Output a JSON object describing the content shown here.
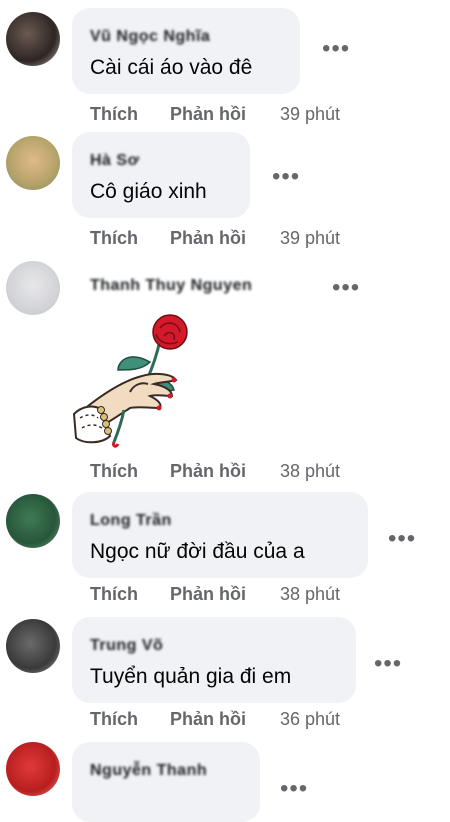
{
  "labels": {
    "like": "Thích",
    "reply": "Phản hồi"
  },
  "more_icon": "more-horizontal-icon",
  "sticker_icon": "hand-holding-rose-sticker",
  "comments": [
    {
      "author": "Vũ Ngọc Nghĩa",
      "text": "Cài cái áo vào đê",
      "time": "39 phút"
    },
    {
      "author": "Hà Sơ",
      "text": "Cô giáo xinh",
      "time": "39 phút"
    },
    {
      "author": "Thanh Thuy Nguyen",
      "text": "",
      "time": "38 phút"
    },
    {
      "author": "Long Trần",
      "text": "Ngọc nữ đời đầu của a",
      "time": "38 phút"
    },
    {
      "author": "Trung Võ",
      "text": "Tuyển quản gia đi em",
      "time": "36 phút"
    },
    {
      "author": "Nguyễn Thanh",
      "text": "",
      "time": ""
    }
  ]
}
